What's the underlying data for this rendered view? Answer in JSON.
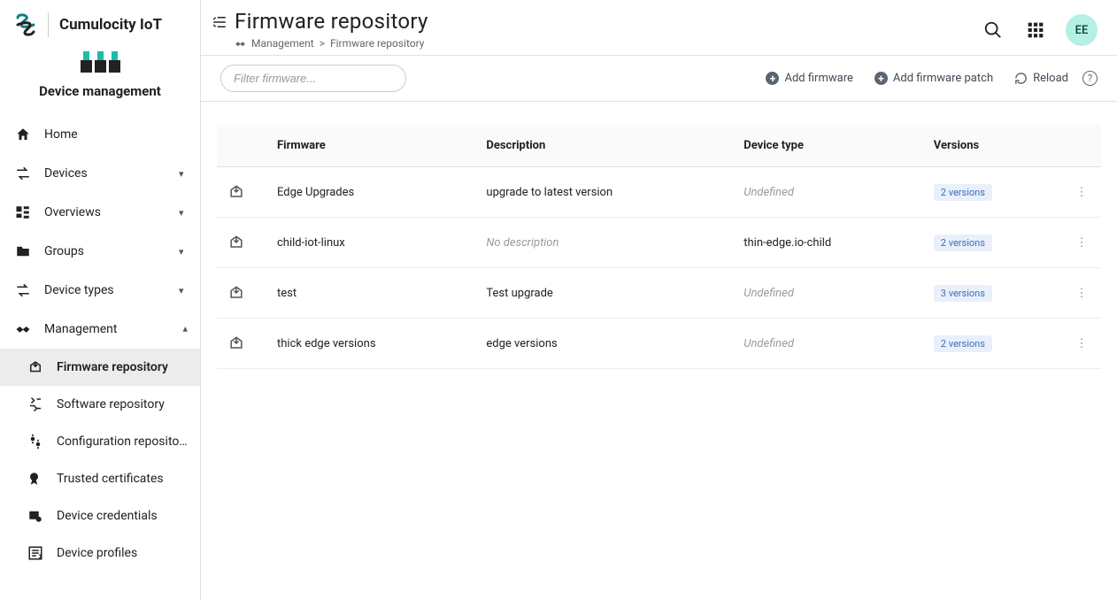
{
  "brand": {
    "name": "Cumulocity IoT"
  },
  "app": {
    "name": "Device management"
  },
  "nav": {
    "home": "Home",
    "devices": "Devices",
    "overviews": "Overviews",
    "groups": "Groups",
    "device_types": "Device types",
    "management": {
      "label": "Management",
      "items": [
        {
          "label": "Firmware repository"
        },
        {
          "label": "Software repository"
        },
        {
          "label": "Configuration reposito..."
        },
        {
          "label": "Trusted certificates"
        },
        {
          "label": "Device credentials"
        },
        {
          "label": "Device profiles"
        }
      ]
    }
  },
  "header": {
    "title": "Firmware repository",
    "breadcrumb_root": "Management",
    "breadcrumb_sep": ">",
    "breadcrumb_leaf": "Firmware repository",
    "avatar_initials": "EE"
  },
  "actionbar": {
    "filter_placeholder": "Filter firmware...",
    "add_firmware": "Add firmware",
    "add_patch": "Add firmware patch",
    "reload": "Reload"
  },
  "table": {
    "headers": {
      "firmware": "Firmware",
      "description": "Description",
      "device_type": "Device type",
      "versions": "Versions"
    },
    "rows": [
      {
        "name": "Edge Upgrades",
        "description": "upgrade to latest version",
        "desc_muted": false,
        "device_type": "Undefined",
        "dev_muted": true,
        "versions": "2 versions"
      },
      {
        "name": "child-iot-linux",
        "description": "No description",
        "desc_muted": true,
        "device_type": "thin-edge.io-child",
        "dev_muted": false,
        "versions": "2 versions"
      },
      {
        "name": "test",
        "description": "Test upgrade",
        "desc_muted": false,
        "device_type": "Undefined",
        "dev_muted": true,
        "versions": "3 versions"
      },
      {
        "name": "thick edge versions",
        "description": "edge versions",
        "desc_muted": false,
        "device_type": "Undefined",
        "dev_muted": true,
        "versions": "2 versions"
      }
    ]
  }
}
